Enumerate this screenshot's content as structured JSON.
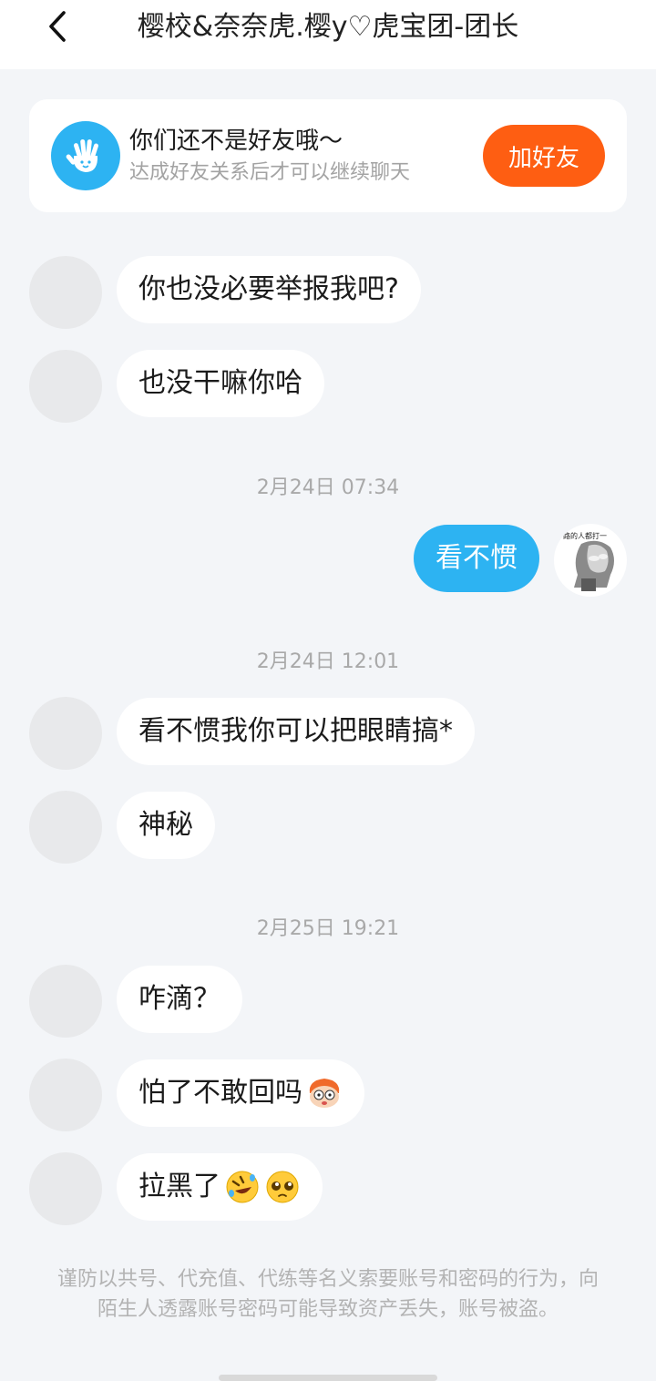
{
  "header": {
    "title": "樱校&奈奈虎.樱y♡虎宝团-团长",
    "back_icon": "chevron-left-icon"
  },
  "friend_card": {
    "title": "你们还不是好友哦～",
    "subtitle": "达成好友关系后才可以继续聊天",
    "button_label": "加好友",
    "icon": "waving-hand-icon",
    "button_color": "#fe5e12",
    "icon_color": "#2db3f2"
  },
  "messages": [
    {
      "side": "left",
      "text": "你也没必要举报我吧?"
    },
    {
      "side": "left",
      "text": "也没干嘛你哈"
    },
    {
      "timestamp": "2月24日 07:34"
    },
    {
      "side": "right",
      "text": "看不惯",
      "avatar_caption": "路的人都打一"
    },
    {
      "timestamp": "2月24日 12:01"
    },
    {
      "side": "left",
      "text": "看不惯我你可以把眼睛搞*"
    },
    {
      "side": "left",
      "text": "神秘"
    },
    {
      "timestamp": "2月25日 19:21"
    },
    {
      "side": "left",
      "text": "咋滴？"
    },
    {
      "side": "left",
      "text": "怕了不敢回吗",
      "emoji": "monkey-face-emoji"
    },
    {
      "side": "left",
      "text": "拉黑了",
      "emoji": [
        "rolling-laughing-emoji",
        "pleading-face-emoji"
      ]
    }
  ],
  "warning": "谨防以共号、代充值、代练等名义索要账号和密码的行为，向陌生人透露账号密码可能导致资产丢失，账号被盗。",
  "colors": {
    "background": "#f3f5f8",
    "bubble_right": "#2db3f2",
    "bubble_left": "#ffffff"
  }
}
